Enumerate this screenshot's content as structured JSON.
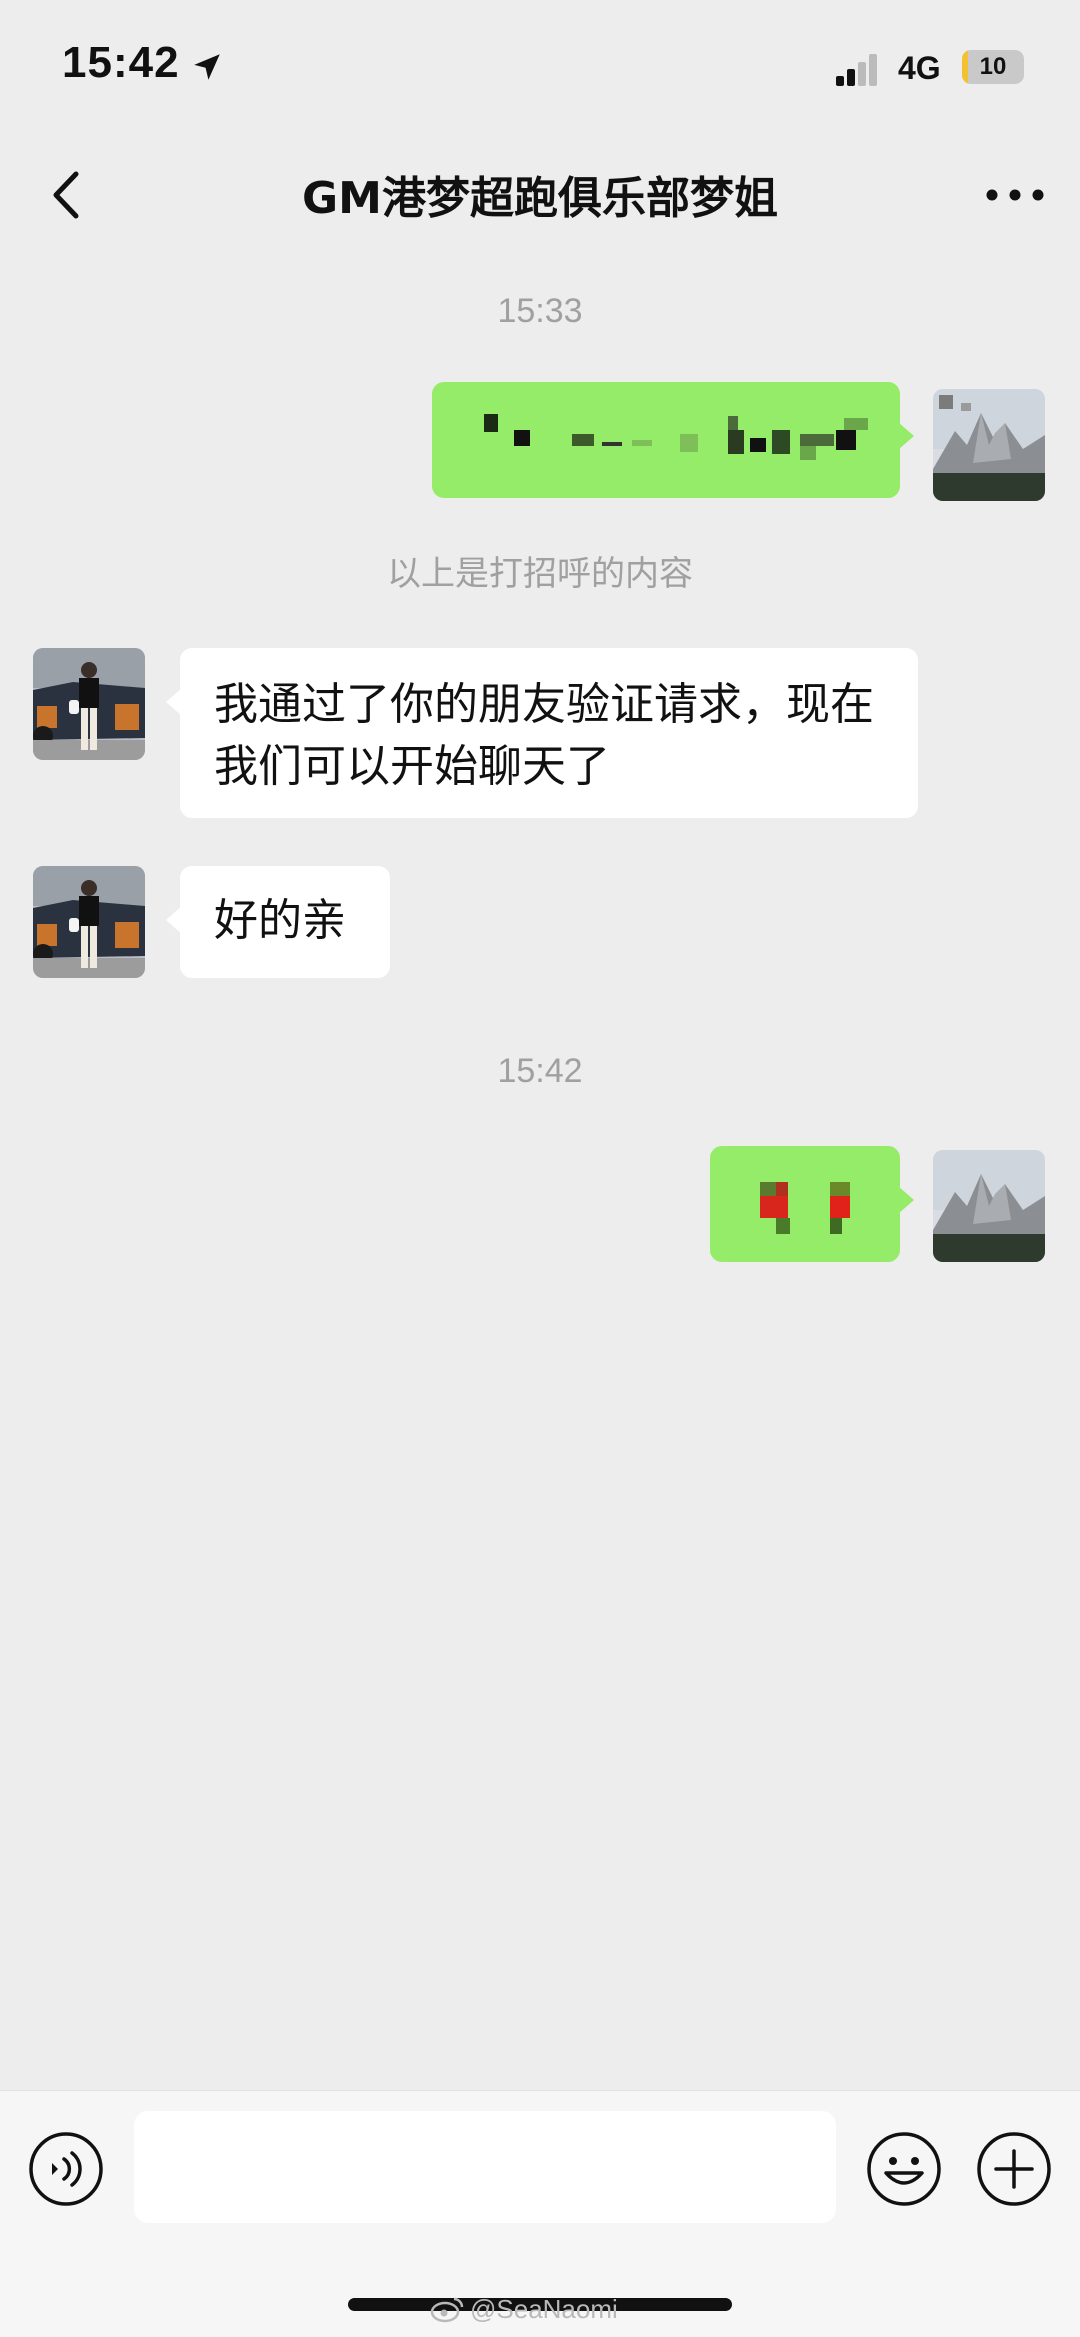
{
  "status_bar": {
    "time": "15:42",
    "network": "4G",
    "battery_label": "10",
    "battery_level": 0.1,
    "colors": {
      "battery_fill": "#f2c230"
    }
  },
  "header": {
    "back_icon": "chevron-left-icon",
    "title": "GM港梦超跑俱乐部梦姐",
    "more_icon": "more-dots-icon"
  },
  "chat": {
    "timestamp_1": "15:33",
    "system_notice": "以上是打招呼的内容",
    "received_1": "我通过了你的朋友验证请求，现在我们可以开始聊天了",
    "received_2": "好的亲",
    "timestamp_2": "15:42",
    "colors": {
      "sent_bubble": "#95ec69",
      "received_bubble": "#ffffff",
      "background": "#ededed"
    }
  },
  "input_bar": {
    "voice_icon": "voice-icon",
    "message_value": "",
    "emoji_icon": "emoji-icon",
    "plus_icon": "plus-icon"
  },
  "watermark": {
    "text": "@SeaNaomi",
    "icon": "weibo-icon"
  }
}
